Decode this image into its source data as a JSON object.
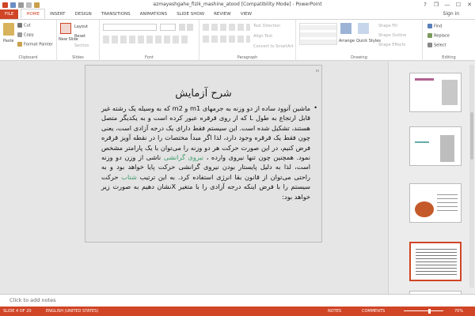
{
  "window": {
    "title": "azmayeshgahe_fizik_mashine_atood [Compatibility Mode] - PowerPoint",
    "controls": [
      "?",
      "❐",
      "—",
      "☐",
      "✕"
    ],
    "sign_in": "Sign in"
  },
  "tabs": [
    "FILE",
    "HOME",
    "INSERT",
    "DESIGN",
    "TRANSITIONS",
    "ANIMATIONS",
    "SLIDE SHOW",
    "REVIEW",
    "VIEW"
  ],
  "active_tab": "HOME",
  "ribbon": {
    "clipboard": {
      "label": "Clipboard",
      "paste": "Paste",
      "cut": "Cut",
      "copy": "Copy",
      "format_painter": "Format Painter"
    },
    "slides": {
      "label": "Slides",
      "new_slide": "New Slide",
      "layout": "Layout",
      "reset": "Reset",
      "section": "Section"
    },
    "font": {
      "label": "Font"
    },
    "paragraph": {
      "label": "Paragraph",
      "text_direction": "Text Direction",
      "align_text": "Align Text",
      "convert": "Convert to SmartArt"
    },
    "drawing": {
      "label": "Drawing",
      "arrange": "Arrange",
      "quick_styles": "Quick Styles",
      "shape_fill": "Shape Fill",
      "shape_outline": "Shape Outline",
      "shape_effects": "Shape Effects"
    },
    "editing": {
      "label": "Editing",
      "find": "Find",
      "replace": "Replace",
      "select": "Select"
    }
  },
  "slide": {
    "title": "شرح آزمایش",
    "bullet": "•",
    "body_1": "ماشین آتوود ساده از دو وزنه به جرمهای m1 و m2 که به وسیله یک رشته غیر قابل ارتجاع به طول L که از روی قرقره عبور کرده است و به یکدیگر متصل هستند، تشکیل شده است. این سیستم فقط دارای یک درجه آزادی است، یعنی چون فقط یک قرقره وجود دارد، لذا اگر مبدأ مختصات را در نقطه آویز قرقره فرض کنیم، در این صورت حرکت هر دو وزنه را می‌توان با یک پارامتر مشخص نمود. همچنین چون تنها نیروی وارده ، ",
    "body_hl1": "نیروی گرانشی",
    "body_2": " ناشی از وزن دو وزنه است، لذا به دلیل پایستار بودن نیروی گرانشی حرکت پایا خواهد بود و به راحتی می‌توان از قانون بقا انرژی استفاده کرد. به این ترتیب ",
    "body_hl2": "شتاب",
    "body_3": " حرکت سیستم را با فرض اینکه درجه آزادی را با متغیر Xنشان دهیم به صورت زیر خواهد بود:",
    "corner_mark": "m"
  },
  "thumbnails": [
    {
      "num": "1"
    },
    {
      "num": "2"
    },
    {
      "num": "3"
    },
    {
      "num": "4"
    }
  ],
  "notes_placeholder": "Click to add notes",
  "status": {
    "slide": "SLIDE 4 OF 20",
    "language": "ENGLISH (UNITED STATES)",
    "notes": "NOTES",
    "comments": "COMMENTS",
    "zoom": "70%"
  },
  "colors": {
    "accent": "#d04526",
    "highlight": "#3c9b6b"
  }
}
